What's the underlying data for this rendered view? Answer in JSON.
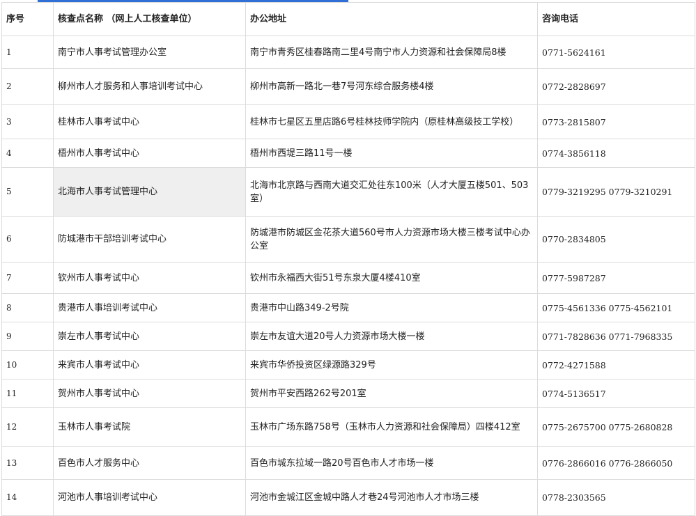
{
  "header": {
    "col1": "序号",
    "col2": "核查点名称 （网上人工核查单位）",
    "col3": "办公地址",
    "col4": "咨询电话"
  },
  "rows": [
    {
      "no": "1",
      "name": "南宁市人事考试管理办公室",
      "address": "南宁市青秀区桂春路南二里4号南宁市人力资源和社会保障局8楼",
      "phone": "0771-5624161"
    },
    {
      "no": "2",
      "name": "柳州市人才服务和人事培训考试中心",
      "address": "柳州市高新一路北一巷7号河东综合服务楼4楼",
      "phone": "0772-2828697"
    },
    {
      "no": "3",
      "name": "桂林市人事考试中心",
      "address": "桂林市七星区五里店路6号桂林技师学院内（原桂林高级技工学校）",
      "phone": "0773-2815807"
    },
    {
      "no": "4",
      "name": "梧州市人事考试中心",
      "address": "梧州市西堤三路11号一楼",
      "phone": "0774-3856118"
    },
    {
      "no": "5",
      "name": "北海市人事考试管理中心",
      "address": "北海市北京路与西南大道交汇处往东100米（人才大厦五楼501、503室）",
      "phone": "0779-3219295  0779-3210291"
    },
    {
      "no": "6",
      "name": "防城港市干部培训考试中心",
      "address": "防城港市防城区金花茶大道560号市人力资源市场大楼三楼考试中心办公室",
      "phone": "0770-2834805"
    },
    {
      "no": "7",
      "name": "钦州市人事考试中心",
      "address": "钦州市永福西大街51号东泉大厦4楼410室",
      "phone": "0777-5987287"
    },
    {
      "no": "8",
      "name": "贵港市人事培训考试中心",
      "address": "贵港市中山路349-2号院",
      "phone": "0775-4561336  0775-4562101"
    },
    {
      "no": "9",
      "name": "崇左市人事考试中心",
      "address": "崇左市友谊大道20号人力资源市场大楼一楼",
      "phone": "0771-7828636  0771-7968335"
    },
    {
      "no": "10",
      "name": "来宾市人事考试中心",
      "address": "来宾市华侨投资区绿源路329号",
      "phone": "0772-4271588"
    },
    {
      "no": "11",
      "name": "贺州市人事考试中心",
      "address": "贺州市平安西路262号201室",
      "phone": "0774-5136517"
    },
    {
      "no": "12",
      "name": "玉林市人事考试院",
      "address": "玉林市广场东路758号（玉林市人力资源和社会保障局）四楼412室",
      "phone": "0775-2675700  0775-2680828"
    },
    {
      "no": "13",
      "name": "百色市人才服务中心",
      "address": "百色市城东拉域一路20号百色市人才市场一楼",
      "phone": "0776-2866016 0776-2866050"
    },
    {
      "no": "14",
      "name": "河池市人事培训考试中心",
      "address": "河池市金城江区金城中路人才巷24号河池市人才市场三楼",
      "phone": "0778-2303565"
    }
  ]
}
